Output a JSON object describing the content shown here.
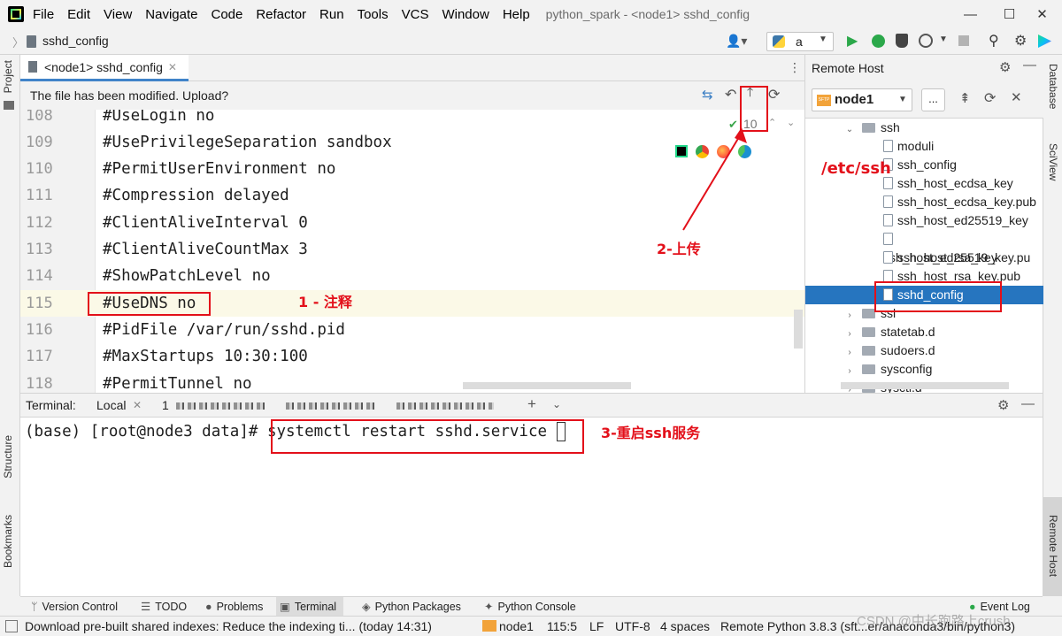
{
  "titlebar": {
    "menu": [
      "File",
      "Edit",
      "View",
      "Navigate",
      "Code",
      "Refactor",
      "Run",
      "Tools",
      "VCS",
      "Window",
      "Help"
    ],
    "window_title": "python_spark - <node1> sshd_config",
    "minimize": "—",
    "maximize": "☐",
    "close": "✕"
  },
  "navbar": {
    "breadcrumb": "sshd_config",
    "run_config": "a"
  },
  "left_tabs": [
    "Project",
    "Structure",
    "Bookmarks"
  ],
  "right_tabs": [
    "Database",
    "SciView",
    "Remote Host"
  ],
  "editor": {
    "tab_label": "<node1> sshd_config",
    "upload_message": "The file has been modified. Upload?",
    "inspection_count": "10",
    "lines": [
      {
        "num": "108",
        "text": "#UseLogin no"
      },
      {
        "num": "109",
        "text": "#UsePrivilegeSeparation sandbox"
      },
      {
        "num": "110",
        "text": "#PermitUserEnvironment no"
      },
      {
        "num": "111",
        "text": "#Compression delayed"
      },
      {
        "num": "112",
        "text": "#ClientAliveInterval 0"
      },
      {
        "num": "113",
        "text": "#ClientAliveCountMax 3"
      },
      {
        "num": "114",
        "text": "#ShowPatchLevel no"
      },
      {
        "num": "115",
        "text": "#UseDNS no"
      },
      {
        "num": "116",
        "text": "#PidFile /var/run/sshd.pid"
      },
      {
        "num": "117",
        "text": "#MaxStartups 10:30:100"
      },
      {
        "num": "118",
        "text": "#PermitTunnel no"
      }
    ]
  },
  "remote_host": {
    "title": "Remote Host",
    "server": "node1",
    "more": "...",
    "tree": [
      {
        "label": "ssh",
        "type": "folder",
        "expanded": true,
        "depth": 1
      },
      {
        "label": "moduli",
        "type": "file",
        "depth": 2
      },
      {
        "label": "ssh_config",
        "type": "file",
        "depth": 2
      },
      {
        "label": "ssh_host_ecdsa_key",
        "type": "file",
        "depth": 2
      },
      {
        "label": "ssh_host_ecdsa_key.pub",
        "type": "file",
        "depth": 2
      },
      {
        "label": "ssh_host_ed25519_key",
        "type": "file",
        "depth": 2
      },
      {
        "label": "ssh_host_ed25519_key.pu",
        "type": "file",
        "depth": 2
      },
      {
        "label": "ssh_host_rsa_key",
        "type": "file",
        "depth": 2
      },
      {
        "label": "ssh_host_rsa_key.pub",
        "type": "file",
        "depth": 2
      },
      {
        "label": "sshd_config",
        "type": "file",
        "depth": 2,
        "selected": true
      },
      {
        "label": "ssl",
        "type": "folder",
        "depth": 1
      },
      {
        "label": "statetab.d",
        "type": "folder",
        "depth": 1
      },
      {
        "label": "sudoers.d",
        "type": "folder",
        "depth": 1
      },
      {
        "label": "sysconfig",
        "type": "folder",
        "depth": 1
      },
      {
        "label": "sysctl.d",
        "type": "folder",
        "depth": 1
      }
    ]
  },
  "terminal": {
    "label": "Terminal:",
    "tab_local": "Local",
    "tab_second": "1",
    "prompt": "(base) [root@node3 data]# ",
    "command": "systemctl restart sshd.service"
  },
  "annotations": {
    "step1": "1 - 注释",
    "step2": "2-上传",
    "step3": "3-重启ssh服务",
    "path": "/etc/ssh"
  },
  "tool_windows": [
    "Version Control",
    "TODO",
    "Problems",
    "Terminal",
    "Python Packages",
    "Python Console"
  ],
  "event_log": "Event Log",
  "statusbar": {
    "message": "Download pre-built shared indexes: Reduce the indexing ti... (today 14:31)",
    "host": "node1",
    "position": "115:5",
    "line_sep": "LF",
    "encoding": "UTF-8",
    "indent": "4 spaces",
    "interpreter": "Remote Python 3.8.3 (sft...er/anaconda3/bin/python3)",
    "watermark": "CSDN @中长跑路上crush"
  },
  "colors": {
    "accent": "#4083c9",
    "selection": "#2675bf",
    "annotation_red": "#e3101a",
    "caret_row": "#fbf9e7"
  }
}
